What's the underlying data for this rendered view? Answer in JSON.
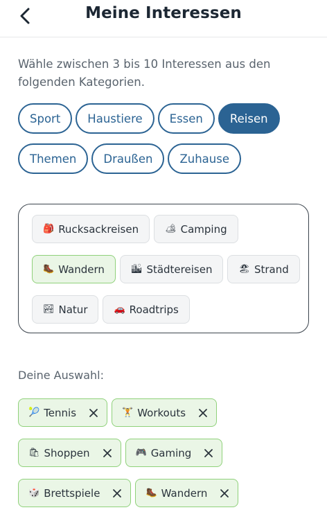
{
  "header": {
    "title": "Meine Interessen",
    "back_icon": "chevron-left-icon"
  },
  "intro": "Wähle zwischen 3 bis 10 Interessen aus den folgenden Kategorien.",
  "categories": {
    "row1": [
      {
        "label": "Sport",
        "active": false
      },
      {
        "label": "Haustiere",
        "active": false
      },
      {
        "label": "Essen",
        "active": false
      },
      {
        "label": "Reisen",
        "active": true
      }
    ],
    "row2": [
      {
        "label": "Themen",
        "active": false
      },
      {
        "label": "Draußen",
        "active": false
      },
      {
        "label": "Zuhause",
        "active": false
      }
    ]
  },
  "options": {
    "row1": [
      {
        "emoji": "🎒",
        "label": "Rucksackreisen",
        "selected": false
      },
      {
        "emoji": "🏕",
        "label": "Camping",
        "selected": false
      }
    ],
    "row2": [
      {
        "emoji": "🥾",
        "label": "Wandern",
        "selected": true
      },
      {
        "emoji": "🏙",
        "label": "Städtereisen",
        "selected": false
      },
      {
        "emoji": "🏖",
        "label": "Strand",
        "selected": false
      }
    ],
    "row3": [
      {
        "emoji": "🏞",
        "label": "Natur",
        "selected": false
      },
      {
        "emoji": "🚗",
        "label": "Roadtrips",
        "selected": false
      }
    ]
  },
  "selection": {
    "label": "Deine Auswahl:",
    "row1": [
      {
        "emoji": "🎾",
        "label": "Tennis"
      },
      {
        "emoji": "🏋",
        "label": "Workouts"
      }
    ],
    "row2": [
      {
        "emoji": "🛍",
        "label": "Shoppen"
      },
      {
        "emoji": "🎮",
        "label": "Gaming"
      }
    ],
    "row3": [
      {
        "emoji": "🎲",
        "label": "Brettspiele"
      },
      {
        "emoji": "🥾",
        "label": "Wandern"
      }
    ]
  },
  "colors": {
    "primary": "#2b6393",
    "selected_fill": "#eaf6e6",
    "selected_border": "#8fd17a",
    "chip_fill": "#f4f5f6"
  }
}
